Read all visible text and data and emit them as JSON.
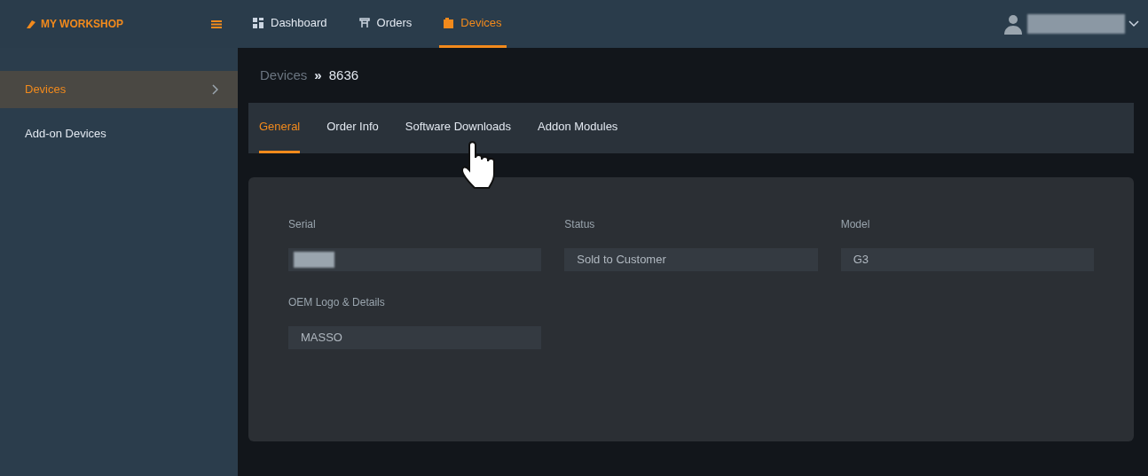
{
  "brand": {
    "name": "MY WORKSHOP"
  },
  "nav": [
    {
      "label": "Dashboard",
      "kind": "dashboard",
      "selected": false
    },
    {
      "label": "Orders",
      "kind": "orders",
      "selected": false
    },
    {
      "label": "Devices",
      "kind": "devices",
      "selected": true
    }
  ],
  "sidebar": {
    "items": [
      {
        "label": "Devices",
        "selected": true
      },
      {
        "label": "Add-on Devices",
        "selected": false
      }
    ]
  },
  "breadcrumb": {
    "parent": "Devices",
    "separator": "»",
    "current": "8636"
  },
  "tabs": [
    {
      "label": "General",
      "selected": true
    },
    {
      "label": "Order Info",
      "selected": false
    },
    {
      "label": "Software Downloads",
      "selected": false
    },
    {
      "label": "Addon Modules",
      "selected": false
    }
  ],
  "fields": [
    {
      "label": "Serial",
      "kind": "redacted"
    },
    {
      "label": "Status",
      "kind": "text",
      "value": "Sold to Customer"
    },
    {
      "label": "Model",
      "kind": "text",
      "value": "G3"
    },
    {
      "label": "OEM Logo & Details",
      "kind": "text",
      "value": "MASSO"
    }
  ]
}
